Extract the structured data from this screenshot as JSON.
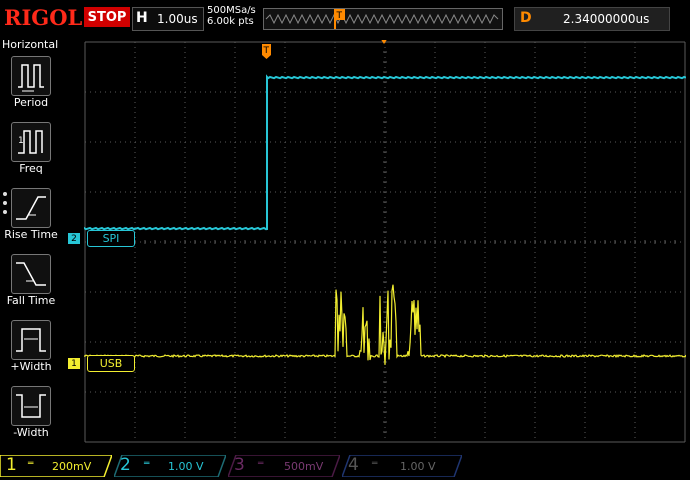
{
  "top": {
    "brand": "RIGOL",
    "run_state": "STOP",
    "timebase_letter": "H",
    "timebase": "1.00us",
    "sample_rate": "500MSa/s",
    "memory_depth": "6.00k pts",
    "trigger_marker": "T",
    "delay_letter": "D",
    "delay": "2.34000000us"
  },
  "sidebar": {
    "title": "Horizontal",
    "items": [
      {
        "label": "Period",
        "icon": "period-icon"
      },
      {
        "label": "Freq",
        "icon": "freq-icon"
      },
      {
        "label": "Rise Time",
        "icon": "rise-time-icon"
      },
      {
        "label": "Fall Time",
        "icon": "fall-time-icon"
      },
      {
        "label": "+Width",
        "icon": "positive-width-icon"
      },
      {
        "label": "-Width",
        "icon": "negative-width-icon"
      }
    ]
  },
  "screen": {
    "trigger_marker": "T",
    "labels": {
      "spi": {
        "number": "2",
        "text": "SPI",
        "color": "#27c6d6"
      },
      "usb": {
        "number": "1",
        "text": "USB",
        "color": "#f2ee30"
      }
    }
  },
  "channels": [
    {
      "number": "1",
      "scale": "200mV",
      "color": "#f2ee30",
      "active": true
    },
    {
      "number": "2",
      "scale": "1.00 V",
      "color": "#27c6d6",
      "active": true
    },
    {
      "number": "3",
      "scale": "500mV",
      "color": "#c03bb0",
      "active": false
    },
    {
      "number": "4",
      "scale": "1.00 V",
      "color": "#3a6ee0",
      "active": false
    }
  ],
  "colors": {
    "brand": "#ff2a1a",
    "stop": "#d10000",
    "ch1": "#f2ee30",
    "ch2": "#27c6d6",
    "trigger": "#ff8a00",
    "grid": "#5a5a5a"
  }
}
